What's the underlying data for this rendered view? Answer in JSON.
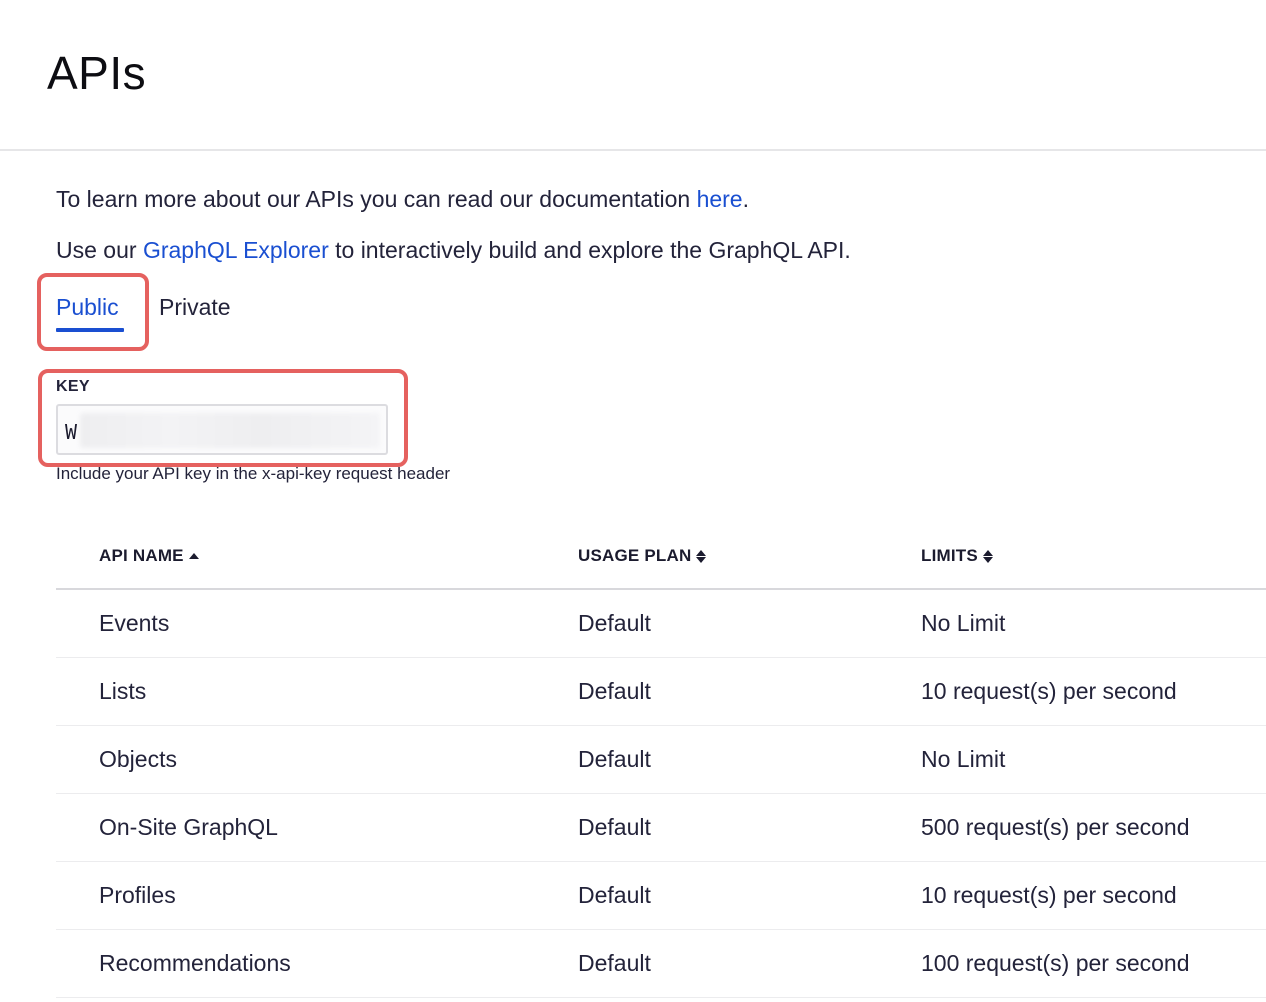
{
  "page": {
    "title": "APIs"
  },
  "intro": {
    "line1_prefix": "To learn more about our APIs you can read our documentation ",
    "line1_link": "here",
    "line1_suffix": ".",
    "line2_prefix": "Use our ",
    "line2_link": "GraphQL Explorer",
    "line2_suffix": " to interactively build and explore the GraphQL API."
  },
  "tabs": {
    "public": "Public",
    "private": "Private",
    "active": "Public"
  },
  "key": {
    "label": "KEY",
    "value": "W",
    "help": "Include your API key in the x-api-key request header"
  },
  "table": {
    "headers": {
      "api_name": "API NAME",
      "usage_plan": "USAGE PLAN",
      "limits": "LIMITS"
    },
    "sort": {
      "column": "API NAME",
      "direction": "ascending"
    },
    "rows": [
      {
        "name": "Events",
        "plan": "Default",
        "limit": "No Limit"
      },
      {
        "name": "Lists",
        "plan": "Default",
        "limit": "10 request(s) per second"
      },
      {
        "name": "Objects",
        "plan": "Default",
        "limit": "No Limit"
      },
      {
        "name": "On-Site GraphQL",
        "plan": "Default",
        "limit": "500 request(s) per second"
      },
      {
        "name": "Profiles",
        "plan": "Default",
        "limit": "10 request(s) per second"
      },
      {
        "name": "Recommendations",
        "plan": "Default",
        "limit": "100 request(s) per second"
      }
    ]
  },
  "colors": {
    "link": "#1a4fd1",
    "highlight": "#e5615f"
  }
}
